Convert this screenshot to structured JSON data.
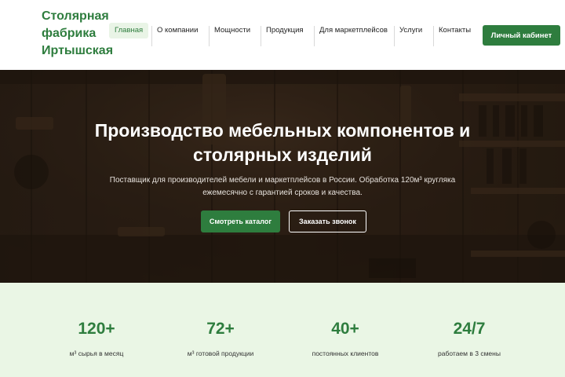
{
  "header": {
    "brand_lines": [
      "Столярная",
      "фабрика",
      "Иртышская"
    ],
    "nav": [
      {
        "label": "Главная",
        "active": true
      },
      {
        "label": "О компании",
        "active": false
      },
      {
        "label": "Мощности",
        "active": false
      },
      {
        "label": "Продукция",
        "active": false
      },
      {
        "label": "Для маркетплейсов",
        "active": false
      },
      {
        "label": "Услуги",
        "active": false
      },
      {
        "label": "Контакты",
        "active": false
      }
    ],
    "cabinet_label": "Личный кабинет"
  },
  "hero": {
    "title_lines": [
      "Производство мебельных компонентов и",
      "столярных изделий"
    ],
    "subtitle_lines": [
      "Поставщик для производителей мебели и маркетплейсов в России. Обработка 120м³ кругляка",
      "ежемесячно с гарантией сроков и качества."
    ],
    "catalog_label": "Смотреть каталог",
    "call_label": "Заказать звонок"
  },
  "stats": [
    {
      "value": "120+",
      "label": "м³ сырья в месяц"
    },
    {
      "value": "72+",
      "label": "м³ готовой продукции"
    },
    {
      "value": "40+",
      "label": "постоянных клиентов"
    },
    {
      "value": "24/7",
      "label": "работаем в 3 смены"
    }
  ],
  "colors": {
    "accent": "#2e7d3e",
    "active_nav_bg": "#e9f4e6",
    "stats_bg": "#eaf6e5"
  }
}
